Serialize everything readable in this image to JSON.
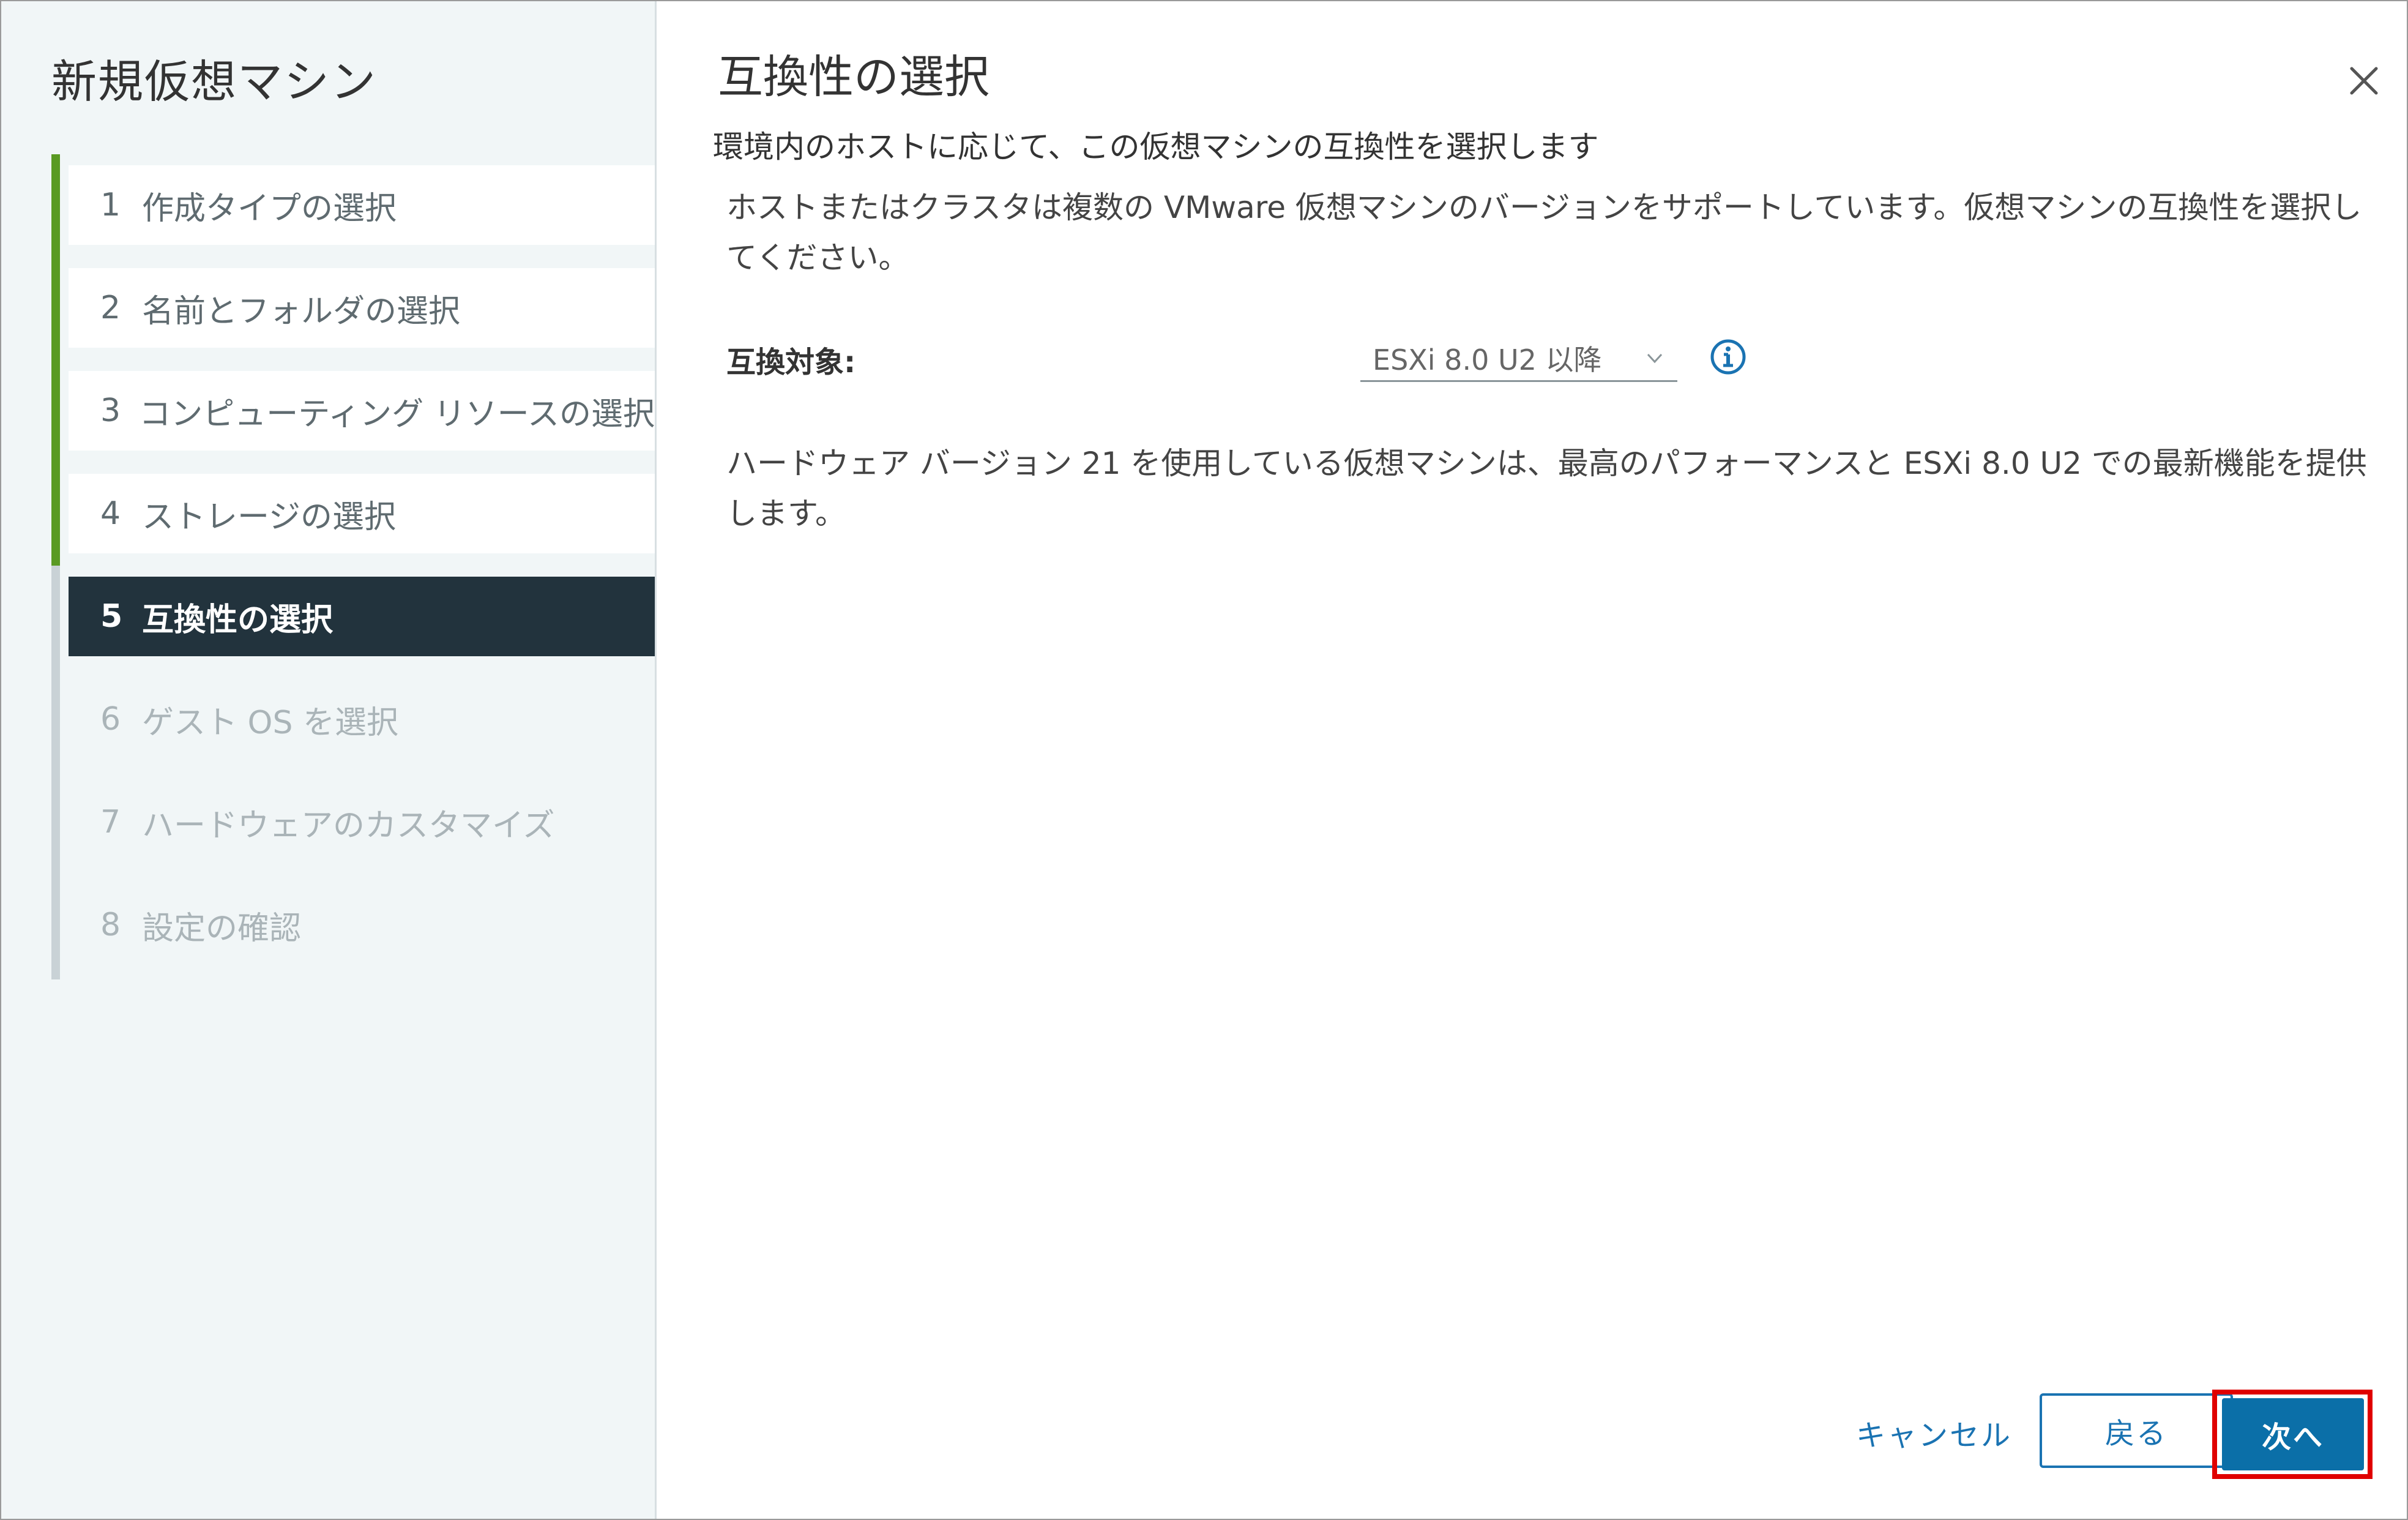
{
  "wizard": {
    "title": "新規仮想マシン",
    "steps": [
      {
        "num": "1",
        "label": "作成タイプの選択",
        "state": "done"
      },
      {
        "num": "2",
        "label": "名前とフォルダの選択",
        "state": "done"
      },
      {
        "num": "3",
        "label": "コンピューティング リソースの選択",
        "state": "done"
      },
      {
        "num": "4",
        "label": "ストレージの選択",
        "state": "done"
      },
      {
        "num": "5",
        "label": "互換性の選択",
        "state": "active"
      },
      {
        "num": "6",
        "label": "ゲスト OS を選択",
        "state": "todo"
      },
      {
        "num": "7",
        "label": "ハードウェアのカスタマイズ",
        "state": "todo"
      },
      {
        "num": "8",
        "label": "設定の確認",
        "state": "todo"
      }
    ]
  },
  "page": {
    "title": "互換性の選択",
    "subtitle": "環境内のホストに応じて、この仮想マシンの互換性を選択します",
    "description": "ホストまたはクラスタは複数の VMware 仮想マシンのバージョンをサポートしています。仮想マシンの互換性を選択してください。",
    "compat_label": "互換対象:",
    "compat_value": "ESXi 8.0 U2 以降",
    "hw_note": "ハードウェア バージョン 21 を使用している仮想マシンは、最高のパフォーマンスと ESXi 8.0 U2 での最新機能を提供します。"
  },
  "footer": {
    "cancel_label": "キャンセル",
    "back_label": "戻る",
    "next_label": "次へ"
  },
  "colors": {
    "accent": "#0b6fa8",
    "link": "#1a73b2",
    "done_bar": "#5a9a23",
    "active_step_bg": "#22333d",
    "highlight": "#e00000"
  },
  "icons": {
    "close": "close-icon",
    "dropdown": "chevron-down-icon",
    "info": "info-icon"
  }
}
